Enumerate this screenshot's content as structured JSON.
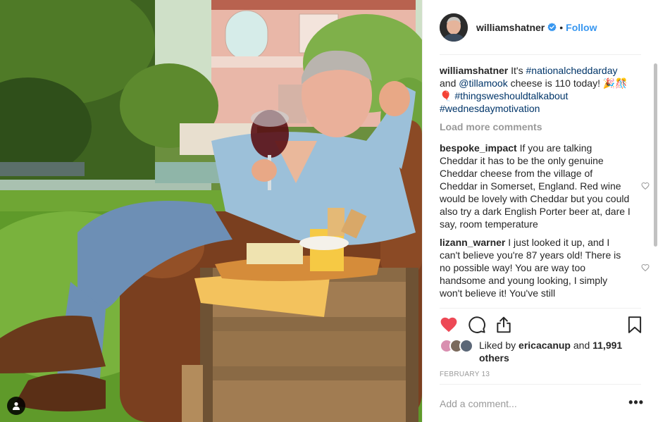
{
  "post": {
    "author": "williamshatner",
    "follow_label": "Follow",
    "separator": "•",
    "caption": {
      "user": "williamshatner",
      "text1": "It's",
      "hashtag1": "#nationalcheddarday",
      "text2": "and",
      "mention": "@tillamook",
      "text3": "cheese is 110 today! 🎉🎊🎈",
      "hashtag2": "#thingsweshouldtalkabout",
      "hashtag3": "#wednesdaymotivation"
    },
    "load_more_label": "Load more comments",
    "comments": [
      {
        "user": "bespoke_impact",
        "text": "If you are talking Cheddar it has to be the only genuine Cheddar cheese from the village of Cheddar in Somerset, England. Red wine would be lovely with Cheddar but you could also try a dark English Porter beer at, dare I say, room temperature"
      },
      {
        "user": "lizann_warner",
        "text": "I just looked it up, and I can't believe you're 87 years old! There is no possible way! You are way too handsome and young looking, I simply won't believe it! You've still"
      }
    ],
    "likes": {
      "prefix": "Liked by",
      "user": "ericacanup",
      "and": "and",
      "others": "11,991 others"
    },
    "date": "FEBRUARY 13",
    "add_comment_placeholder": "Add a comment...",
    "more_options": "•••"
  },
  "icons": {
    "like": "heart-filled-icon",
    "comment": "comment-bubble-icon",
    "share": "share-icon",
    "save": "bookmark-icon",
    "verified": "verified-badge-icon",
    "user_tags": "user-tag-icon"
  },
  "colors": {
    "like_red": "#ed4956",
    "link_blue": "#3897f0",
    "hashtag_navy": "#003569",
    "muted_gray": "#999999"
  }
}
